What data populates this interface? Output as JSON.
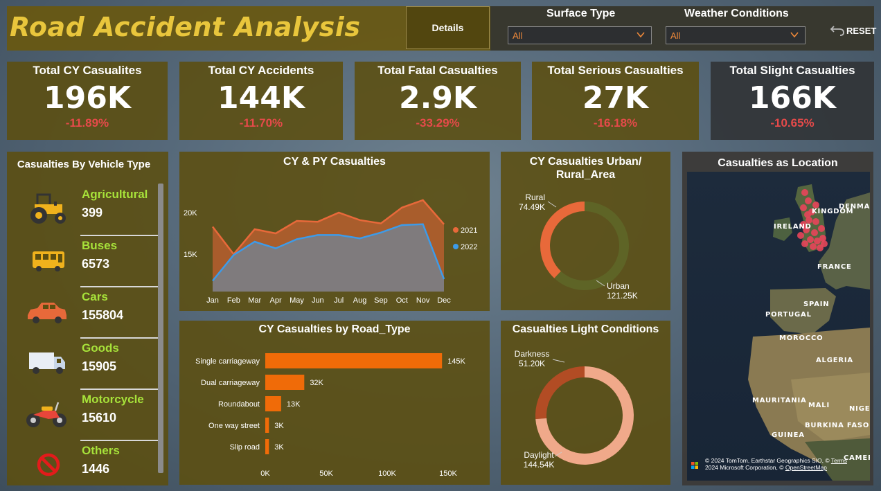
{
  "header": {
    "title": "Road Accident Analysis",
    "details_label": "Details",
    "surface_label": "Surface Type",
    "surface_value": "All",
    "weather_label": "Weather Conditions",
    "weather_value": "All",
    "reset_label": "RESET"
  },
  "kpis": [
    {
      "title": "Total CY Casualites",
      "value": "196K",
      "change": "-11.89%"
    },
    {
      "title": "Total CY Accidents",
      "value": "144K",
      "change": "-11.70%"
    },
    {
      "title": "Total Fatal Casualties",
      "value": "2.9K",
      "change": "-33.29%"
    },
    {
      "title": "Total Serious Casualties",
      "value": "27K",
      "change": "-16.18%"
    },
    {
      "title": "Total Slight Casualties",
      "value": "166K",
      "change": "-10.65%"
    }
  ],
  "vehicles": {
    "title": "Casualties By Vehicle Type",
    "items": [
      {
        "name": "Agricultural",
        "count": "399",
        "icon": "tractor-icon"
      },
      {
        "name": "Buses",
        "count": "6573",
        "icon": "bus-icon"
      },
      {
        "name": "Cars",
        "count": "155804",
        "icon": "car-icon"
      },
      {
        "name": "Goods",
        "count": "15905",
        "icon": "truck-icon"
      },
      {
        "name": "Motorcycle",
        "count": "15610",
        "icon": "motorcycle-icon"
      },
      {
        "name": "Others",
        "count": "1446",
        "icon": "prohibited-icon"
      }
    ]
  },
  "map": {
    "title": "Casualties as Location",
    "labels": [
      "UNITED KINGDOM",
      "IRELAND",
      "DENMARK",
      "FRANCE",
      "SPAIN",
      "PORTUGAL",
      "MOROCCO",
      "ALGERIA",
      "MAURITANIA",
      "MALI",
      "NIGER",
      "BURKINA FASO",
      "GUINEA",
      "CAMEROON"
    ],
    "credit_line1": "© 2024 TomTom, Earthstar Geographics SIO, ©",
    "credit_terms": "Terms",
    "credit_line2": "2024 Microsoft Corporation, ©",
    "credit_osm": "OpenStreetMap"
  },
  "colors": {
    "accent_title": "#e9c63c",
    "series_2021": "#e8693a",
    "series_2022": "#3d9be9",
    "bar": "#f06b08",
    "negative": "#e64a4a",
    "vehicle_label": "#a7e23a"
  },
  "chart_data": [
    {
      "type": "area",
      "title": "CY & PY Casualties",
      "x": [
        "Jan",
        "Feb",
        "Mar",
        "Apr",
        "May",
        "Jun",
        "Jul",
        "Aug",
        "Sep",
        "Oct",
        "Nov",
        "Dec"
      ],
      "y_ticks": [
        "15K",
        "20K"
      ],
      "ylim": [
        10500,
        24000
      ],
      "legend": "right",
      "series": [
        {
          "name": "2021",
          "values": [
            18300,
            15000,
            18000,
            17500,
            19000,
            18900,
            20000,
            19100,
            18700,
            20600,
            21500,
            18600
          ]
        },
        {
          "name": "2022",
          "values": [
            11800,
            14900,
            16500,
            15700,
            16800,
            17300,
            17300,
            16900,
            17600,
            18500,
            18600,
            12000
          ]
        }
      ]
    },
    {
      "type": "bar",
      "orientation": "horizontal",
      "title": "CY Casualties by Road_Type",
      "categories": [
        "Single carriageway",
        "Dual carriageway",
        "Roundabout",
        "One way street",
        "Slip road"
      ],
      "values": [
        145000,
        32000,
        13000,
        3000,
        3000
      ],
      "data_labels": [
        "145K",
        "32K",
        "13K",
        "3K",
        "3K"
      ],
      "x_ticks": [
        "0K",
        "50K",
        "100K",
        "150K"
      ],
      "xlim": [
        0,
        150000
      ]
    },
    {
      "type": "pie",
      "title": "CY Casualties Urban/ Rural_Area",
      "labels": [
        "Rural",
        "Urban"
      ],
      "values": [
        74.49,
        121.25
      ],
      "data_labels": [
        "74.49K",
        "121.25K"
      ]
    },
    {
      "type": "pie",
      "title": "Casualties Light Conditions",
      "labels": [
        "Darkness",
        "Daylight"
      ],
      "values": [
        51.2,
        144.54
      ],
      "data_labels": [
        "51.20K",
        "144.54K"
      ]
    }
  ]
}
